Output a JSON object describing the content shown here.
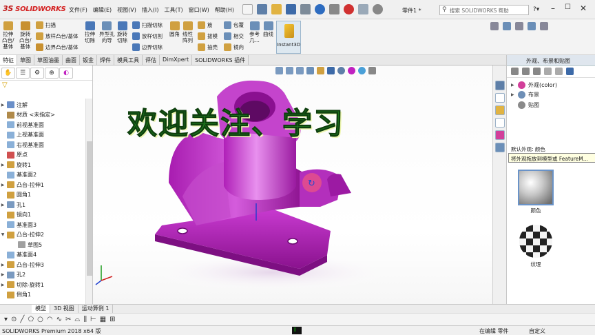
{
  "titlebar": {
    "logo": "SOLIDWORKS",
    "logo_mark": "3S",
    "document": "零件1 *",
    "search_placeholder": "搜索 SOLIDWORKS 帮助",
    "menu": [
      "文件(F)",
      "编辑(E)",
      "视图(V)",
      "插入(I)",
      "工具(T)",
      "窗口(W)",
      "帮助(H)"
    ]
  },
  "ribbon": {
    "extrude_boss": [
      "拉伸",
      "凸台/",
      "基体"
    ],
    "revolve_boss": [
      "旋转",
      "凸台/",
      "基体"
    ],
    "sweep": "扫描",
    "loft": "放样凸台/基体",
    "boundary_boss": "边界凸台/基体",
    "extrude_cut": [
      "拉伸",
      "切除"
    ],
    "hole_wizard": [
      "异型孔",
      "向导"
    ],
    "revolve_cut": [
      "旋转",
      "切除"
    ],
    "sweep_cut": "扫描切除",
    "loft_cut": "放样切割",
    "boundary_cut": "边界切除",
    "fillet": "圆角",
    "linear_pattern": [
      "线性",
      "阵列"
    ],
    "rib": "筋",
    "draft": "拔模",
    "shell": "抽壳",
    "wrap": "包覆",
    "intersect": "相交",
    "mirror": "镜向",
    "reference": [
      "参考",
      "几..."
    ],
    "curves": "曲线",
    "instant3d": "Instant3D"
  },
  "tabs": [
    "特征",
    "草图",
    "草图油墨",
    "曲面",
    "钣金",
    "焊件",
    "模具工具",
    "评估",
    "DimXpert",
    "SOLIDWORKS 插件"
  ],
  "tree": [
    {
      "label": "注解",
      "color": "#6a8fc8",
      "exp": "▶"
    },
    {
      "label": "材质 <未指定>",
      "color": "#b08a4a",
      "exp": ""
    },
    {
      "label": "前视基准面",
      "color": "#8ab0d8",
      "exp": ""
    },
    {
      "label": "上视基准面",
      "color": "#8ab0d8",
      "exp": ""
    },
    {
      "label": "右视基准面",
      "color": "#8ab0d8",
      "exp": ""
    },
    {
      "label": "原点",
      "color": "#d05050",
      "exp": ""
    },
    {
      "label": "旋转1",
      "color": "#d0a040",
      "exp": "▶"
    },
    {
      "label": "基准面2",
      "color": "#8ab0d8",
      "exp": ""
    },
    {
      "label": "凸台-拉伸1",
      "color": "#d0a040",
      "exp": "▶"
    },
    {
      "label": "圆角1",
      "color": "#d0a040",
      "exp": ""
    },
    {
      "label": "孔1",
      "color": "#7a9ac0",
      "exp": "▶"
    },
    {
      "label": "镜向1",
      "color": "#d0a040",
      "exp": ""
    },
    {
      "label": "基准面3",
      "color": "#8ab0d8",
      "exp": ""
    },
    {
      "label": "凸台-拉伸2",
      "color": "#d0a040",
      "exp": "▼"
    },
    {
      "label": "草图5",
      "color": "#a0a0a0",
      "exp": "",
      "indent": true
    },
    {
      "label": "基准面4",
      "color": "#8ab0d8",
      "exp": ""
    },
    {
      "label": "凸台-拉伸3",
      "color": "#d0a040",
      "exp": "▶"
    },
    {
      "label": "孔2",
      "color": "#7a9ac0",
      "exp": "▶"
    },
    {
      "label": "切除-旋转1",
      "color": "#d0a040",
      "exp": "▶"
    },
    {
      "label": "倒角1",
      "color": "#d0a040",
      "exp": ""
    }
  ],
  "bottom_tabs": [
    "模型",
    "3D 视图",
    "运动算例 1"
  ],
  "overlay_text": "欢迎关注、学习",
  "right_panel": {
    "title": "外观、布景和贴图",
    "tree": [
      {
        "label": "外观(color)",
        "exp": "▶",
        "color": "#d23f9a"
      },
      {
        "label": "布景",
        "exp": "▶",
        "color": "#6e8fb6"
      },
      {
        "label": "贴图",
        "exp": "",
        "color": "#8a8a8a"
      }
    ],
    "default_appearance": "默认外观: 颜色",
    "tooltip": "将外观拖放到模型或 FeatureM...",
    "swatch_color": "颜色",
    "swatch_texture": "纹理"
  },
  "status": {
    "app": "SOLIDWORKS Premium 2018 x64 版",
    "mode": "在编辑 零件",
    "units": "自定义"
  },
  "colors": {
    "part": "#c021c0",
    "overlay": "#1f7a1f",
    "accent": "#d42020"
  }
}
